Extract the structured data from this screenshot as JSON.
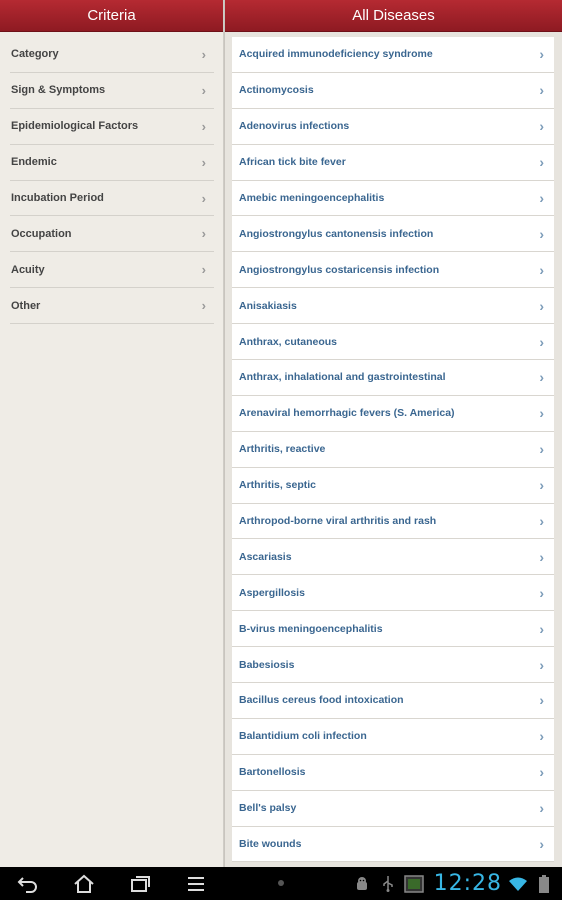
{
  "left": {
    "title": "Criteria",
    "items": [
      {
        "label": "Category"
      },
      {
        "label": "Sign & Symptoms"
      },
      {
        "label": "Epidemiological Factors"
      },
      {
        "label": "Endemic"
      },
      {
        "label": "Incubation Period"
      },
      {
        "label": "Occupation"
      },
      {
        "label": "Acuity"
      },
      {
        "label": "Other"
      }
    ]
  },
  "right": {
    "title": "All Diseases",
    "items": [
      {
        "label": "Acquired immunodeficiency syndrome"
      },
      {
        "label": "Actinomycosis"
      },
      {
        "label": "Adenovirus infections"
      },
      {
        "label": "African tick bite fever"
      },
      {
        "label": "Amebic meningoencephalitis"
      },
      {
        "label": "Angiostrongylus cantonensis infection"
      },
      {
        "label": "Angiostrongylus costaricensis infection"
      },
      {
        "label": "Anisakiasis"
      },
      {
        "label": "Anthrax, cutaneous"
      },
      {
        "label": "Anthrax, inhalational and gastrointestinal"
      },
      {
        "label": "Arenaviral hemorrhagic fevers (S. America)"
      },
      {
        "label": "Arthritis, reactive"
      },
      {
        "label": "Arthritis, septic"
      },
      {
        "label": "Arthropod-borne viral arthritis and rash"
      },
      {
        "label": "Ascariasis"
      },
      {
        "label": "Aspergillosis"
      },
      {
        "label": "B-virus meningoencephalitis"
      },
      {
        "label": "Babesiosis"
      },
      {
        "label": "Bacillus cereus food intoxication"
      },
      {
        "label": "Balantidium coli infection"
      },
      {
        "label": "Bartonellosis"
      },
      {
        "label": "Bell's palsy"
      },
      {
        "label": "Bite wounds"
      }
    ]
  },
  "system_bar": {
    "clock": "12:28",
    "icons": [
      "back-icon",
      "home-icon",
      "recent-apps-icon",
      "menu-icon",
      "android-debug-icon",
      "usb-icon",
      "screenshot-icon",
      "wifi-icon",
      "battery-icon"
    ],
    "clock_color": "#38b6e4"
  },
  "colors": {
    "header": "#a3242c",
    "disease_text": "#3a6690",
    "criteria_text": "#444444"
  }
}
